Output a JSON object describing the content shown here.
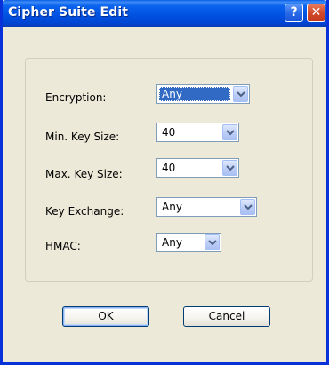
{
  "window": {
    "title": "Cipher Suite Edit",
    "help_label": "?",
    "close_label": "✕"
  },
  "form": {
    "fields": [
      {
        "label": "Encryption:",
        "value": "Any",
        "selected": true
      },
      {
        "label": "Min. Key Size:",
        "value": "40"
      },
      {
        "label": "Max. Key Size:",
        "value": "40"
      },
      {
        "label": "Key Exchange:",
        "value": "Any"
      },
      {
        "label": "HMAC:",
        "value": "Any"
      }
    ]
  },
  "buttons": {
    "ok": "OK",
    "cancel": "Cancel"
  },
  "colors": {
    "titlebar": "#0054e3",
    "dialog_bg": "#ece9d8",
    "selection": "#316ac5",
    "close_button": "#d2482b"
  },
  "icons": {
    "help": "help-icon",
    "close": "close-icon",
    "dropdown": "chevron-down-icon"
  }
}
